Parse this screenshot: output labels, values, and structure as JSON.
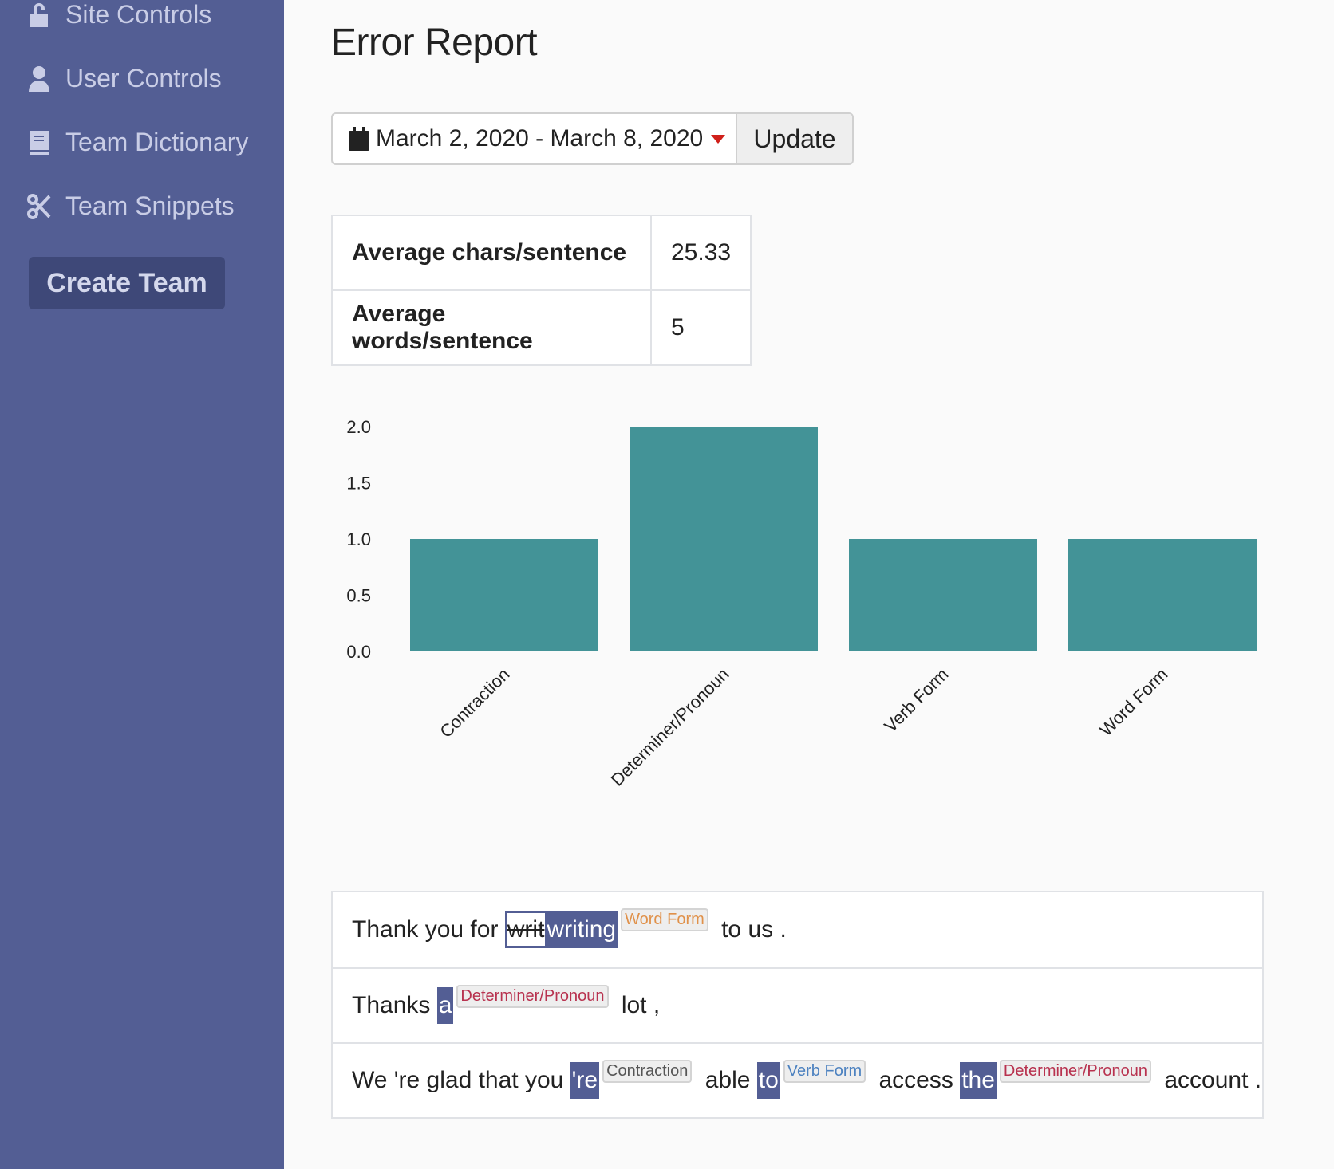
{
  "sidebar": {
    "items": [
      {
        "label": "Site Controls",
        "icon": "lock-open-icon"
      },
      {
        "label": "User Controls",
        "icon": "user-icon"
      },
      {
        "label": "Team Dictionary",
        "icon": "book-icon"
      },
      {
        "label": "Team Snippets",
        "icon": "scissors-icon"
      }
    ],
    "create_team": "Create Team"
  },
  "header": {
    "title": "Error Report"
  },
  "date_range": {
    "value": "March 2, 2020 - March 8, 2020",
    "update_label": "Update"
  },
  "stats": [
    {
      "label": "Average chars/sentence",
      "value": "25.33"
    },
    {
      "label": "Average words/sentence",
      "value": "5"
    }
  ],
  "colors": {
    "sidebar": "#535e94",
    "bar": "#439397",
    "word_form": "#e0914a",
    "determiner": "#b8324f",
    "contraction": "#555555",
    "verb_form": "#4d82c0"
  },
  "chart_data": {
    "type": "bar",
    "categories": [
      "Contraction",
      "Determiner/Pronoun",
      "Verb Form",
      "Word Form"
    ],
    "values": [
      1,
      2,
      1,
      1
    ],
    "ylim": [
      0,
      2
    ],
    "yticks": [
      "0.0",
      "0.5",
      "1.0",
      "1.5",
      "2.0"
    ],
    "grid": false,
    "color": "#439397"
  },
  "sentences": [
    {
      "parts": [
        {
          "t": "Thank you for "
        },
        {
          "del": "writ",
          "t": "writing",
          "hl": true
        },
        {
          "tag": "Word Form",
          "c": "word_form"
        },
        {
          "t": " to us ."
        }
      ]
    },
    {
      "parts": [
        {
          "t": "Thanks "
        },
        {
          "t": "a",
          "hl": true
        },
        {
          "tag": "Determiner/Pronoun",
          "c": "determiner"
        },
        {
          "t": " lot ,"
        }
      ]
    },
    {
      "parts": [
        {
          "t": "We 're glad that you "
        },
        {
          "t": "'re",
          "hl": true
        },
        {
          "tag": "Contraction",
          "c": "contraction"
        },
        {
          "t": " able "
        },
        {
          "t": "to",
          "hl": true
        },
        {
          "tag": "Verb Form",
          "c": "verb_form"
        },
        {
          "t": " access "
        },
        {
          "t": "the",
          "hl": true
        },
        {
          "tag": "Determiner/Pronoun",
          "c": "determiner"
        },
        {
          "t": " account ."
        }
      ]
    }
  ]
}
